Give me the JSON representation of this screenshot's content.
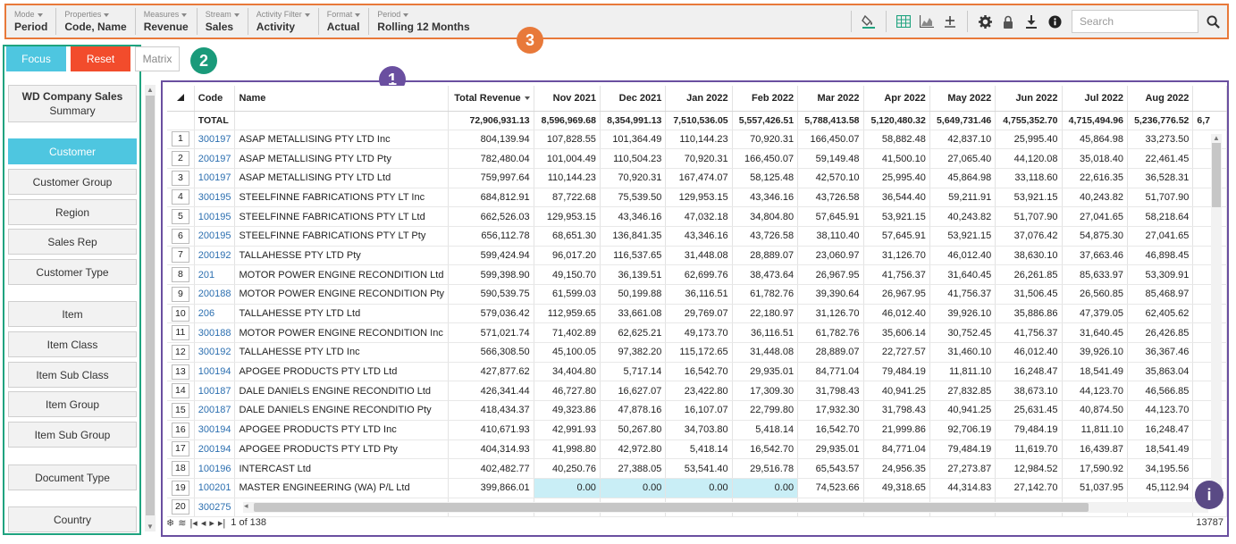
{
  "toolbar": {
    "groups": [
      {
        "label": "Mode",
        "value": "Period"
      },
      {
        "label": "Properties",
        "value": "Code, Name"
      },
      {
        "label": "Measures",
        "value": "Revenue"
      },
      {
        "label": "Stream",
        "value": "Sales"
      },
      {
        "label": "Activity Filter",
        "value": "Activity"
      },
      {
        "label": "Format",
        "value": "Actual"
      },
      {
        "label": "Period",
        "value": "Rolling 12 Months"
      }
    ],
    "search_placeholder": "Search",
    "icons": [
      "paint-bucket-icon",
      "table-view-icon",
      "chart-view-icon",
      "add-measure-icon",
      "settings-icon",
      "lock-icon",
      "download-icon",
      "info-icon",
      "search-icon"
    ]
  },
  "callouts": {
    "one": "1",
    "two": "2",
    "three": "3"
  },
  "left": {
    "focus_label": "Focus",
    "reset_label": "Reset",
    "matrix_label": "Matrix",
    "summary_title": "WD Company Sales",
    "summary_sub": "Summary",
    "dimensions": [
      "Customer",
      "Customer Group",
      "Region",
      "Sales Rep",
      "Customer Type",
      "Item",
      "Item Class",
      "Item Sub Class",
      "Item Group",
      "Item Sub Group",
      "Document Type",
      "Country"
    ],
    "active_dimension": "Customer"
  },
  "grid": {
    "headers": [
      "Code",
      "Name",
      "Total Revenue",
      "Nov 2021",
      "Dec 2021",
      "Jan 2022",
      "Feb 2022",
      "Mar 2022",
      "Apr 2022",
      "May 2022",
      "Jun 2022",
      "Jul 2022",
      "Aug 2022"
    ],
    "total": {
      "label": "TOTAL",
      "values": [
        "72,906,931.13",
        "8,596,969.68",
        "8,354,991.13",
        "7,510,536.05",
        "5,557,426.51",
        "5,788,413.58",
        "5,120,480.32",
        "5,649,731.46",
        "4,755,352.70",
        "4,715,494.96",
        "5,236,776.52",
        "6,7"
      ]
    },
    "rows": [
      {
        "n": "1",
        "code": "300197",
        "name": "ASAP METALLISING PTY LTD Inc",
        "v": [
          "804,139.94",
          "107,828.55",
          "101,364.49",
          "110,144.23",
          "70,920.31",
          "166,450.07",
          "58,882.48",
          "42,837.10",
          "25,995.40",
          "45,864.98",
          "33,273.50"
        ]
      },
      {
        "n": "2",
        "code": "200197",
        "name": "ASAP METALLISING PTY LTD Pty",
        "v": [
          "782,480.04",
          "101,004.49",
          "110,504.23",
          "70,920.31",
          "166,450.07",
          "59,149.48",
          "41,500.10",
          "27,065.40",
          "44,120.08",
          "35,018.40",
          "22,461.45"
        ]
      },
      {
        "n": "3",
        "code": "100197",
        "name": "ASAP METALLISING PTY LTD Ltd",
        "v": [
          "759,997.64",
          "110,144.23",
          "70,920.31",
          "167,474.07",
          "58,125.48",
          "42,570.10",
          "25,995.40",
          "45,864.98",
          "33,118.60",
          "22,616.35",
          "36,528.31"
        ]
      },
      {
        "n": "4",
        "code": "300195",
        "name": "STEELFINNE FABRICATIONS PTY LT Inc",
        "v": [
          "684,812.91",
          "87,722.68",
          "75,539.50",
          "129,953.15",
          "43,346.16",
          "43,726.58",
          "36,544.40",
          "59,211.91",
          "53,921.15",
          "40,243.82",
          "51,707.90"
        ]
      },
      {
        "n": "5",
        "code": "100195",
        "name": "STEELFINNE FABRICATIONS PTY LT Ltd",
        "v": [
          "662,526.03",
          "129,953.15",
          "43,346.16",
          "47,032.18",
          "34,804.80",
          "57,645.91",
          "53,921.15",
          "40,243.82",
          "51,707.90",
          "27,041.65",
          "58,218.64"
        ]
      },
      {
        "n": "6",
        "code": "200195",
        "name": "STEELFINNE FABRICATIONS PTY LT Pty",
        "v": [
          "656,112.78",
          "68,651.30",
          "136,841.35",
          "43,346.16",
          "43,726.58",
          "38,110.40",
          "57,645.91",
          "53,921.15",
          "37,076.42",
          "54,875.30",
          "27,041.65"
        ]
      },
      {
        "n": "7",
        "code": "200192",
        "name": "TALLAHESSE PTY LTD Pty",
        "v": [
          "599,424.94",
          "96,017.20",
          "116,537.65",
          "31,448.08",
          "28,889.07",
          "23,060.97",
          "31,126.70",
          "46,012.40",
          "38,630.10",
          "37,663.46",
          "46,898.45"
        ]
      },
      {
        "n": "8",
        "code": "201",
        "name": "MOTOR POWER ENGINE RECONDITION Ltd",
        "v": [
          "599,398.90",
          "49,150.70",
          "36,139.51",
          "62,699.76",
          "38,473.64",
          "26,967.95",
          "41,756.37",
          "31,640.45",
          "26,261.85",
          "85,633.97",
          "53,309.91"
        ]
      },
      {
        "n": "9",
        "code": "200188",
        "name": "MOTOR POWER ENGINE RECONDITION Pty",
        "v": [
          "590,539.75",
          "61,599.03",
          "50,199.88",
          "36,116.51",
          "61,782.76",
          "39,390.64",
          "26,967.95",
          "41,756.37",
          "31,506.45",
          "26,560.85",
          "85,468.97"
        ]
      },
      {
        "n": "10",
        "code": "206",
        "name": "TALLAHESSE PTY LTD Ltd",
        "v": [
          "579,036.42",
          "112,959.65",
          "33,661.08",
          "29,769.07",
          "22,180.97",
          "31,126.70",
          "46,012.40",
          "39,926.10",
          "35,886.86",
          "47,379.05",
          "62,405.62"
        ]
      },
      {
        "n": "11",
        "code": "300188",
        "name": "MOTOR POWER ENGINE RECONDITION Inc",
        "v": [
          "571,021.74",
          "71,402.89",
          "62,625.21",
          "49,173.70",
          "36,116.51",
          "61,782.76",
          "35,606.14",
          "30,752.45",
          "41,756.37",
          "31,640.45",
          "26,426.85"
        ]
      },
      {
        "n": "12",
        "code": "300192",
        "name": "TALLAHESSE PTY LTD Inc",
        "v": [
          "566,308.50",
          "45,100.05",
          "97,382.20",
          "115,172.65",
          "31,448.08",
          "28,889.07",
          "22,727.57",
          "31,460.10",
          "46,012.40",
          "39,926.10",
          "36,367.46"
        ]
      },
      {
        "n": "13",
        "code": "100194",
        "name": "APOGEE PRODUCTS PTY LTD Ltd",
        "v": [
          "427,877.62",
          "34,404.80",
          "5,717.14",
          "16,542.70",
          "29,935.01",
          "84,771.04",
          "79,484.19",
          "11,811.10",
          "16,248.47",
          "18,541.49",
          "35,863.04"
        ]
      },
      {
        "n": "14",
        "code": "100187",
        "name": "DALE DANIELS ENGINE RECONDITIO Ltd",
        "v": [
          "426,341.44",
          "46,727.80",
          "16,627.07",
          "23,422.80",
          "17,309.30",
          "31,798.43",
          "40,941.25",
          "27,832.85",
          "38,673.10",
          "44,123.70",
          "46,566.85"
        ]
      },
      {
        "n": "15",
        "code": "200187",
        "name": "DALE DANIELS ENGINE RECONDITIO Pty",
        "v": [
          "418,434.37",
          "49,323.86",
          "47,878.16",
          "16,107.07",
          "22,799.80",
          "17,932.30",
          "31,798.43",
          "40,941.25",
          "25,631.45",
          "40,874.50",
          "44,123.70"
        ]
      },
      {
        "n": "16",
        "code": "300194",
        "name": "APOGEE PRODUCTS PTY LTD Inc",
        "v": [
          "410,671.93",
          "42,991.93",
          "50,267.80",
          "34,703.80",
          "5,418.14",
          "16,542.70",
          "21,999.86",
          "92,706.19",
          "79,484.19",
          "11,811.10",
          "16,248.47"
        ]
      },
      {
        "n": "17",
        "code": "200194",
        "name": "APOGEE PRODUCTS PTY LTD Pty",
        "v": [
          "404,314.93",
          "41,998.80",
          "42,972.80",
          "5,418.14",
          "16,542.70",
          "29,935.01",
          "84,771.04",
          "79,484.19",
          "11,619.70",
          "16,439.87",
          "18,541.49"
        ]
      },
      {
        "n": "18",
        "code": "100196",
        "name": "INTERCAST Ltd",
        "v": [
          "402,482.77",
          "40,250.76",
          "27,388.05",
          "53,541.40",
          "29,516.78",
          "65,543.57",
          "24,956.35",
          "27,273.87",
          "12,984.52",
          "17,590.92",
          "34,195.56"
        ]
      },
      {
        "n": "19",
        "code": "100201",
        "name": "MASTER ENGINEERING (WA) P/L Ltd",
        "v": [
          "399,866.01",
          "0.00",
          "0.00",
          "0.00",
          "0.00",
          "74,523.66",
          "49,318.65",
          "44,314.83",
          "27,142.70",
          "51,037.95",
          "45,112.94"
        ]
      },
      {
        "n": "20",
        "code": "300275",
        "name": "",
        "v": [
          "",
          "",
          "",
          "",
          "",
          "",
          "",
          "",
          "",
          "",
          ""
        ]
      }
    ],
    "highlight_row": "19",
    "pager_text": "1 of 138",
    "record_count": "13787"
  }
}
